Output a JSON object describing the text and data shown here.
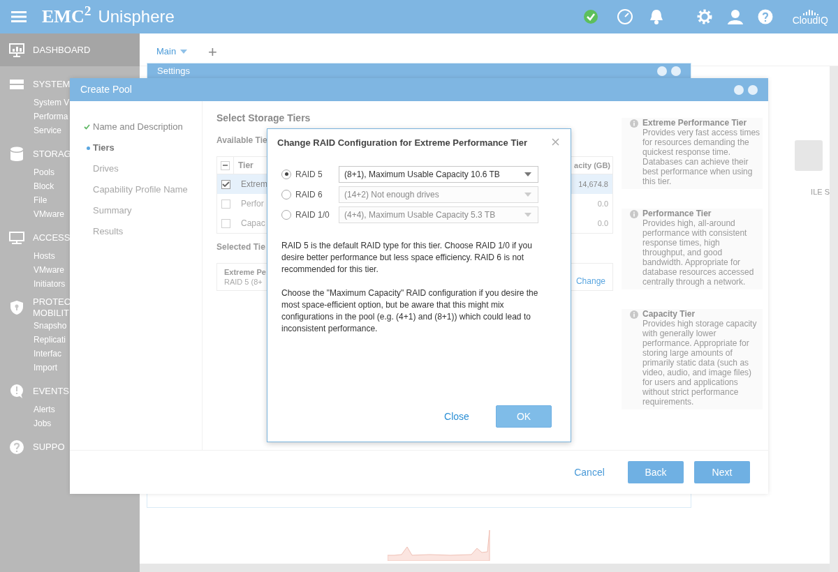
{
  "header": {
    "logo": "EMC$^{2}$",
    "app_name": "Unisphere",
    "cloud_label": "CloudIQ"
  },
  "sidebar": {
    "sections": [
      {
        "lines": [
          "DASHBOARD"
        ],
        "selected": true
      },
      {
        "lines": [
          "SYSTEM"
        ],
        "selected": false,
        "items": [
          "System V",
          "Performa",
          "Service"
        ]
      },
      {
        "lines": [
          "STORAG"
        ],
        "selected": false,
        "items": [
          "Pools",
          "Block",
          "File",
          "VMware"
        ]
      },
      {
        "lines": [
          "ACCESS"
        ],
        "selected": false,
        "items": [
          "Hosts",
          "VMware",
          "Initiators"
        ]
      },
      {
        "lines": [
          "PROTEC",
          "MOBILIT"
        ],
        "selected": false,
        "items": [
          "Snapsho",
          "Replicati",
          "Interfac",
          "Import"
        ]
      },
      {
        "lines": [
          "EVENTS"
        ],
        "selected": false,
        "items": [
          "Alerts",
          "Jobs"
        ]
      },
      {
        "lines": [
          "SUPPO"
        ],
        "selected": false
      }
    ]
  },
  "main": {
    "tabs": [
      {
        "label": "Main",
        "selected": true
      }
    ],
    "add_tab": "+",
    "background_label": "ILE S"
  },
  "settings_window": {
    "title": "Settings"
  },
  "create_pool": {
    "title": "Create Pool",
    "steps": [
      {
        "label": "Name and Description",
        "completed": true,
        "selected": false
      },
      {
        "label": "Tiers",
        "completed": false,
        "selected": true
      },
      {
        "label": "Drives",
        "completed": false,
        "selected": false
      },
      {
        "label": "Capability Profile Name",
        "completed": false,
        "selected": false
      },
      {
        "label": "Summary",
        "completed": false,
        "selected": false
      },
      {
        "label": "Results",
        "completed": false,
        "selected": false
      }
    ],
    "heading": "Select Storage Tiers",
    "available_label": "Available Tie",
    "table": {
      "header_indeterminate": true,
      "columns": [
        "Tier",
        "acity (GB)"
      ],
      "rows": [
        {
          "checked": true,
          "selected": true,
          "tier": "Extrem",
          "capacity": "14,674.8"
        },
        {
          "checked": false,
          "selected": false,
          "tier": "Perfor",
          "capacity": "0.0"
        },
        {
          "checked": false,
          "selected": false,
          "tier": "Capac",
          "capacity": "0.0"
        }
      ]
    },
    "selected_label": "Selected Tie",
    "selected_tier": {
      "name": "Extreme Pe",
      "detail": "RAID 5 (8+",
      "action": "Change"
    },
    "tier_info": [
      {
        "title": "Extreme Performance Tier",
        "text": "Provides very fast access times for resources demanding the quickest response time. Databases can achieve their best performance when using this tier."
      },
      {
        "title": "Performance Tier",
        "text": "Provides high, all-around performance with consistent response times, high throughput, and good bandwidth. Appropriate for database resources accessed centrally through a network."
      },
      {
        "title": "Capacity Tier",
        "text": "Provides high storage capacity with generally lower performance. Appropriate for storing large amounts of primarily static data (such as video, audio, and image files) for users and applications without strict performance requirements."
      }
    ],
    "buttons": [
      {
        "label": "Cancel",
        "kind": "link"
      },
      {
        "label": "Back",
        "kind": "primary"
      },
      {
        "label": "Next",
        "kind": "primary"
      }
    ]
  },
  "dialog": {
    "title": "Change RAID Configuration for Extreme Performance Tier",
    "options": [
      {
        "label": "RAID 5",
        "selected": true,
        "value": "(8+1), Maximum Usable Capacity 10.6 TB",
        "disabled": false
      },
      {
        "label": "RAID 6",
        "selected": false,
        "value": "(14+2) Not enough drives",
        "disabled": true
      },
      {
        "label": "RAID 1/0",
        "selected": false,
        "value": "(4+4), Maximum Usable Capacity 5.3 TB",
        "disabled": true
      }
    ],
    "paragraphs": [
      "RAID 5 is the default RAID type for this tier. Choose RAID 1/0 if you desire better performance but less space efficiency. RAID 6 is not recommended for this tier.",
      "Choose the \"Maximum Capacity\" RAID configuration if you desire the most space-efficient option, but be aware that this might mix configurations in the pool (e.g. (4+1) and (8+1)) which could lead to inconsistent performance."
    ],
    "buttons": [
      {
        "label": "Close",
        "kind": "link"
      },
      {
        "label": "OK",
        "kind": "primary"
      }
    ]
  }
}
